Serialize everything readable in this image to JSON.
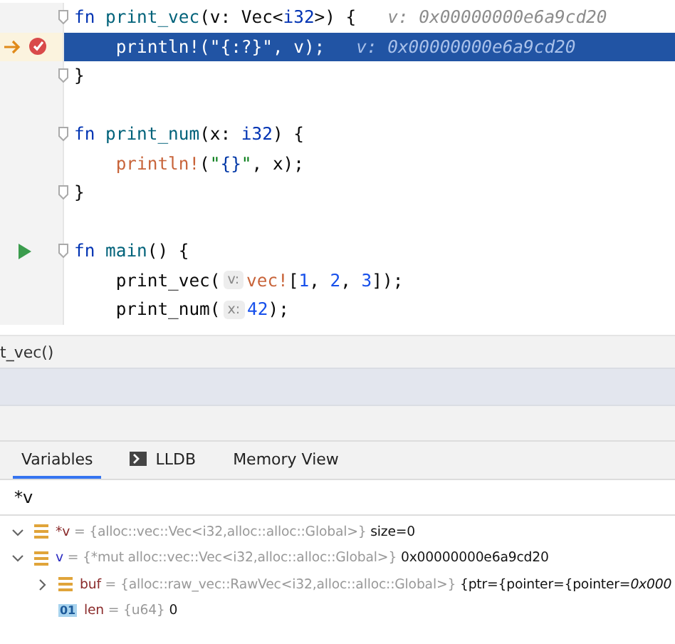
{
  "editor": {
    "lines": [
      {
        "fold": true,
        "indent": false,
        "breakpoint": false,
        "runnable": false,
        "current": false,
        "tokens": [
          {
            "kind": "kw",
            "text": "fn"
          },
          {
            "kind": "fn",
            "text": "print_vec"
          },
          {
            "kind": "plain",
            "text": "(v: Vec<"
          },
          {
            "kind": "prim",
            "text": "i32"
          },
          {
            "kind": "plain",
            "text": ">) {"
          }
        ],
        "inline_value": "v: 0x00000000e6a9cd20"
      },
      {
        "fold": false,
        "indent": true,
        "breakpoint": true,
        "runnable": false,
        "current": true,
        "tokens": [
          {
            "kind": "macro",
            "text": "println!"
          },
          {
            "kind": "plain",
            "text": "("
          },
          {
            "kind": "str",
            "text": "\""
          },
          {
            "kind": "fmt",
            "text": "{:?}"
          },
          {
            "kind": "str",
            "text": "\""
          },
          {
            "kind": "plain",
            "text": ", v);"
          }
        ],
        "inline_value": "v: 0x00000000e6a9cd20"
      },
      {
        "fold": true,
        "indent": false,
        "breakpoint": false,
        "runnable": false,
        "current": false,
        "tokens": [
          {
            "kind": "plain",
            "text": "}"
          }
        ]
      },
      {
        "fold": false,
        "breakpoint": false,
        "runnable": false,
        "current": false
      },
      {
        "fold": true,
        "indent": false,
        "breakpoint": false,
        "runnable": false,
        "current": false,
        "tokens": [
          {
            "kind": "kw",
            "text": "fn"
          },
          {
            "kind": "fn",
            "text": "print_num"
          },
          {
            "kind": "plain",
            "text": "(x: "
          },
          {
            "kind": "prim",
            "text": "i32"
          },
          {
            "kind": "plain",
            "text": ") {"
          }
        ]
      },
      {
        "fold": false,
        "indent": true,
        "breakpoint": false,
        "runnable": false,
        "current": false,
        "tokens": [
          {
            "kind": "macro",
            "text": "println!"
          },
          {
            "kind": "plain",
            "text": "("
          },
          {
            "kind": "str",
            "text": "\""
          },
          {
            "kind": "fmt",
            "text": "{}"
          },
          {
            "kind": "str",
            "text": "\""
          },
          {
            "kind": "plain",
            "text": ", x);"
          }
        ]
      },
      {
        "fold": true,
        "indent": false,
        "breakpoint": false,
        "runnable": false,
        "current": false,
        "tokens": [
          {
            "kind": "plain",
            "text": "}"
          }
        ]
      },
      {
        "fold": false,
        "breakpoint": false,
        "runnable": false,
        "current": false
      },
      {
        "fold": true,
        "indent": false,
        "breakpoint": false,
        "runnable": true,
        "current": false,
        "tokens": [
          {
            "kind": "kw",
            "text": "fn"
          },
          {
            "kind": "fn",
            "text": "main"
          },
          {
            "kind": "plain",
            "text": "() {"
          }
        ]
      },
      {
        "fold": false,
        "indent": true,
        "breakpoint": false,
        "runnable": false,
        "current": false,
        "tokens": [
          {
            "kind": "plain",
            "text": "print_vec("
          },
          {
            "kind": "param",
            "text": "v:"
          },
          {
            "kind": "macro",
            "text": "vec!"
          },
          {
            "kind": "plain",
            "text": "["
          },
          {
            "kind": "num",
            "text": "1"
          },
          {
            "kind": "plain",
            "text": ", "
          },
          {
            "kind": "num",
            "text": "2"
          },
          {
            "kind": "plain",
            "text": ", "
          },
          {
            "kind": "num",
            "text": "3"
          },
          {
            "kind": "plain",
            "text": "]);"
          }
        ]
      },
      {
        "fold": false,
        "indent": true,
        "breakpoint": false,
        "runnable": false,
        "current": false,
        "tokens": [
          {
            "kind": "plain",
            "text": "print_num("
          },
          {
            "kind": "param",
            "text": "x:"
          },
          {
            "kind": "num",
            "text": "42"
          },
          {
            "kind": "plain",
            "text": ");"
          }
        ]
      }
    ]
  },
  "frames": [
    {
      "label": "t_vec()",
      "selected": false
    },
    {
      "selected": true
    }
  ],
  "tabs": [
    {
      "label": "Variables",
      "selected": true,
      "kind": "plain"
    },
    {
      "label": "LLDB",
      "selected": false,
      "kind": "console"
    },
    {
      "label": "Memory View",
      "selected": false,
      "kind": "plain"
    }
  ],
  "watch": {
    "value": "*v"
  },
  "variables": [
    {
      "kind": "struct",
      "expanded": true,
      "name": "*v",
      "color": "#8b2c2c",
      "eq": "=",
      "type": "{alloc::vec::Vec<i32,alloc::alloc::Global>}",
      "value": "size=0"
    },
    {
      "kind": "struct",
      "expanded": true,
      "name": "v",
      "color": "#2e2ec2",
      "eq": "=",
      "type": "{*mut alloc::vec::Vec<i32,alloc::alloc::Global>}",
      "value": "0x00000000e6a9cd20",
      "children": [
        {
          "kind": "struct",
          "expanded": false,
          "name": "buf",
          "color": "#8b2c2c",
          "eq": "=",
          "type": "{alloc::raw_vec::RawVec<i32,alloc::alloc::Global>}",
          "value": "{ptr={pointer={pointer=*0x000*"
        },
        {
          "kind": "number",
          "badge": "01",
          "name": "len",
          "color": "#8b2c2c",
          "eq": "=",
          "type": "{u64}",
          "value": "0"
        }
      ]
    }
  ]
}
